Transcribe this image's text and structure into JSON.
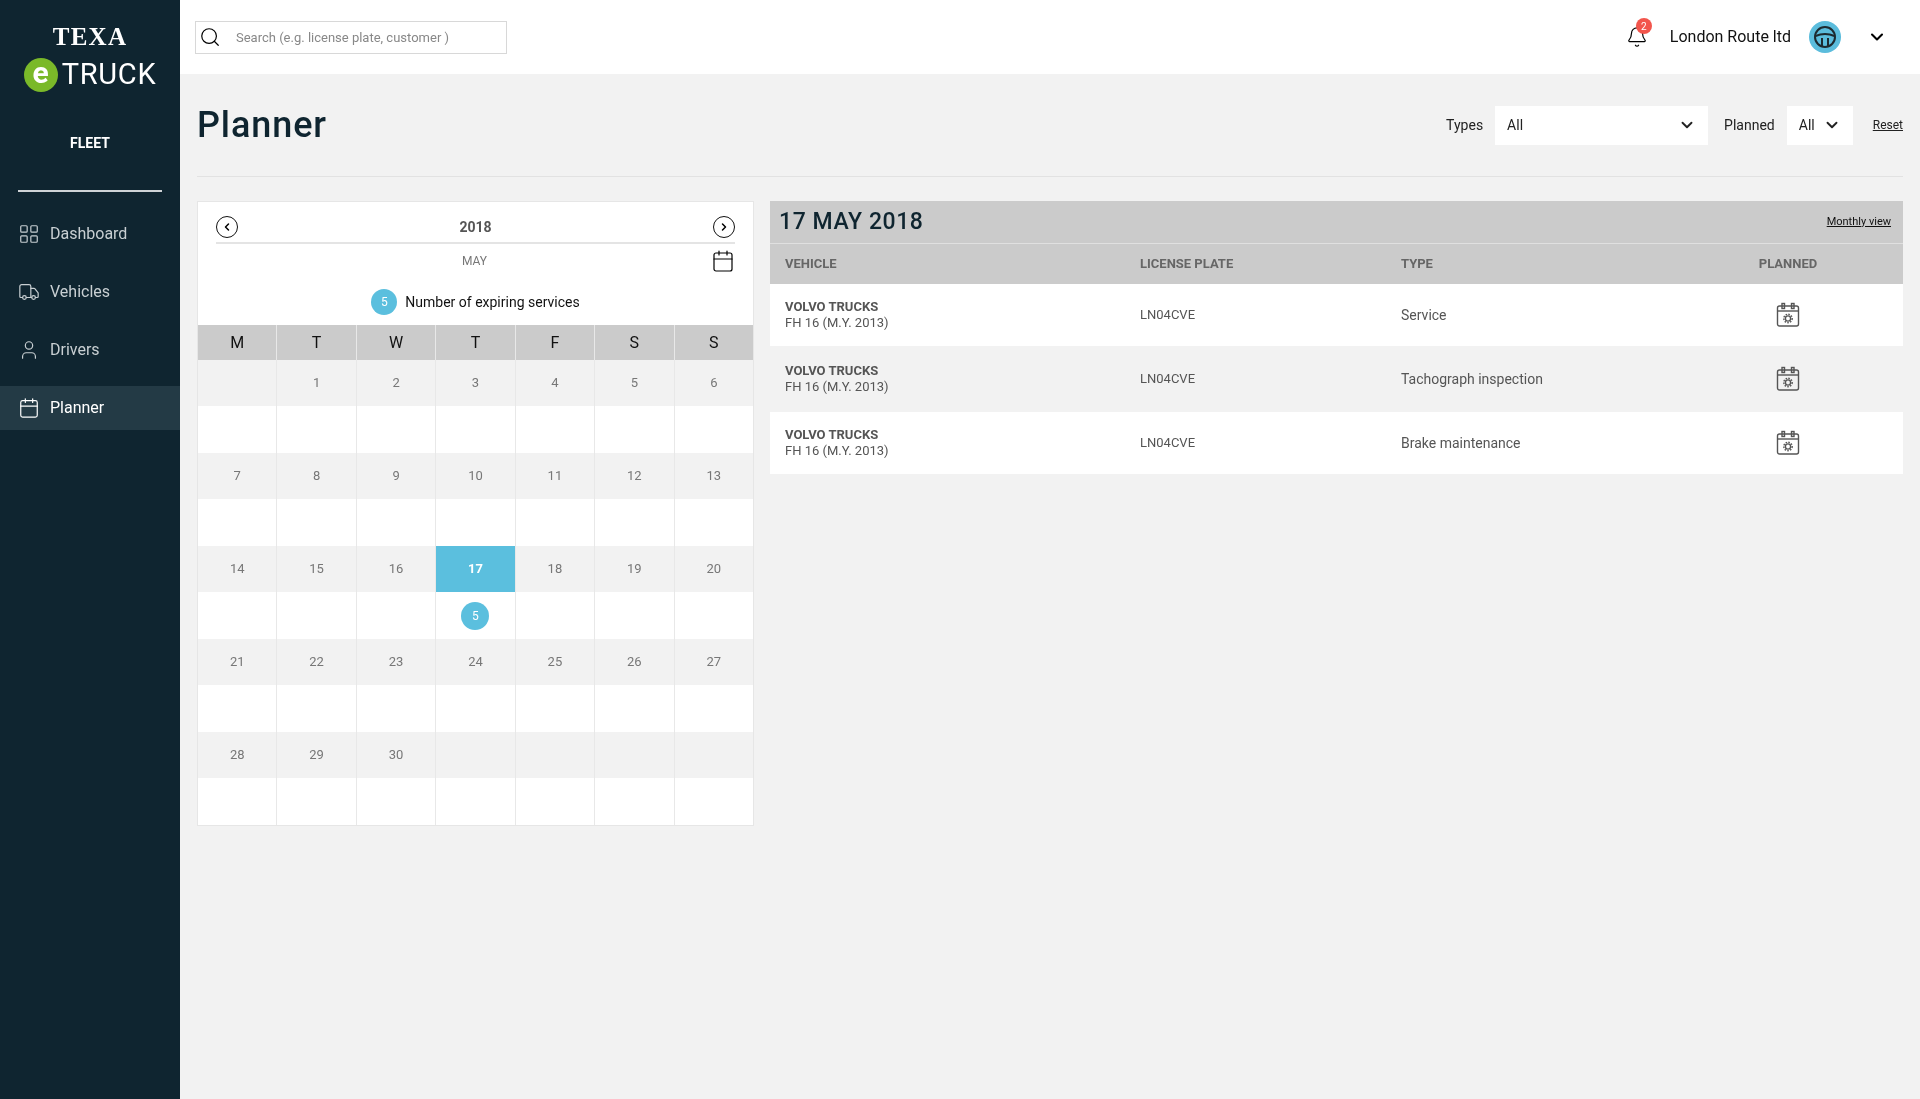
{
  "logo": {
    "brand": "TEXA",
    "letter": "e",
    "product": "TRUCK"
  },
  "sidebar": {
    "section": "FLEET",
    "items": [
      {
        "label": "Dashboard",
        "selected": false
      },
      {
        "label": "Vehicles",
        "selected": false
      },
      {
        "label": "Drivers",
        "selected": false
      },
      {
        "label": "Planner",
        "selected": true
      }
    ]
  },
  "topbar": {
    "search": {
      "placeholder": "Search (e.g. license plate, customer )"
    },
    "notifications": "2",
    "account": "London Route ltd"
  },
  "page": {
    "title": "Planner",
    "filters": [
      {
        "label": "Types",
        "value": "All",
        "kind": "wide"
      },
      {
        "label": "Planned",
        "value": "All",
        "kind": "narrow"
      }
    ],
    "reset": "Reset"
  },
  "calendar": {
    "year": "2018",
    "month": "MAY",
    "legend": {
      "count": "5",
      "label": "Number of expiring services"
    },
    "weekdays": [
      "M",
      "T",
      "W",
      "T",
      "F",
      "S",
      "S"
    ],
    "weeks": [
      [
        {
          "kind": "empty"
        },
        {
          "kind": "day",
          "day": "1",
          "selected": false
        },
        {
          "kind": "day",
          "day": "2",
          "selected": false
        },
        {
          "kind": "day",
          "day": "3",
          "selected": false
        },
        {
          "kind": "day",
          "day": "4",
          "selected": false
        },
        {
          "kind": "day",
          "day": "5",
          "selected": false
        },
        {
          "kind": "day",
          "day": "6",
          "selected": false
        }
      ],
      [
        {
          "kind": "day",
          "day": "7",
          "selected": false
        },
        {
          "kind": "day",
          "day": "8",
          "selected": false
        },
        {
          "kind": "day",
          "day": "9",
          "selected": false
        },
        {
          "kind": "day",
          "day": "10",
          "selected": false
        },
        {
          "kind": "day",
          "day": "11",
          "selected": false
        },
        {
          "kind": "day",
          "day": "12",
          "selected": false
        },
        {
          "kind": "day",
          "day": "13",
          "selected": false
        }
      ],
      [
        {
          "kind": "day",
          "day": "14",
          "selected": false
        },
        {
          "kind": "day",
          "day": "15",
          "selected": false
        },
        {
          "kind": "day",
          "day": "16",
          "selected": false
        },
        {
          "kind": "day",
          "day": "17",
          "selected": true,
          "count": "5"
        },
        {
          "kind": "day",
          "day": "18",
          "selected": false
        },
        {
          "kind": "day",
          "day": "19",
          "selected": false
        },
        {
          "kind": "day",
          "day": "20",
          "selected": false
        }
      ],
      [
        {
          "kind": "day",
          "day": "21",
          "selected": false
        },
        {
          "kind": "day",
          "day": "22",
          "selected": false
        },
        {
          "kind": "day",
          "day": "23",
          "selected": false
        },
        {
          "kind": "day",
          "day": "24",
          "selected": false
        },
        {
          "kind": "day",
          "day": "25",
          "selected": false
        },
        {
          "kind": "day",
          "day": "26",
          "selected": false
        },
        {
          "kind": "day",
          "day": "27",
          "selected": false
        }
      ],
      [
        {
          "kind": "day",
          "day": "28",
          "selected": false
        },
        {
          "kind": "day",
          "day": "29",
          "selected": false
        },
        {
          "kind": "day",
          "day": "30",
          "selected": false
        },
        {
          "kind": "empty"
        },
        {
          "kind": "empty"
        },
        {
          "kind": "empty"
        },
        {
          "kind": "empty"
        }
      ]
    ]
  },
  "services": {
    "date": "17 MAY 2018",
    "view_link": "Monthly view",
    "columns": [
      "VEHICLE",
      "LICENSE PLATE",
      "TYPE",
      "PLANNED"
    ],
    "rows": [
      {
        "make": "VOLVO TRUCKS",
        "model": "FH 16 (M.Y. 2013)",
        "plate": "LN04CVE",
        "type": "Service"
      },
      {
        "make": "VOLVO TRUCKS",
        "model": "FH 16 (M.Y. 2013)",
        "plate": "LN04CVE",
        "type": "Tachograph inspection"
      },
      {
        "make": "VOLVO TRUCKS",
        "model": "FH 16 (M.Y. 2013)",
        "plate": "LN04CVE",
        "type": "Brake maintenance"
      }
    ]
  }
}
